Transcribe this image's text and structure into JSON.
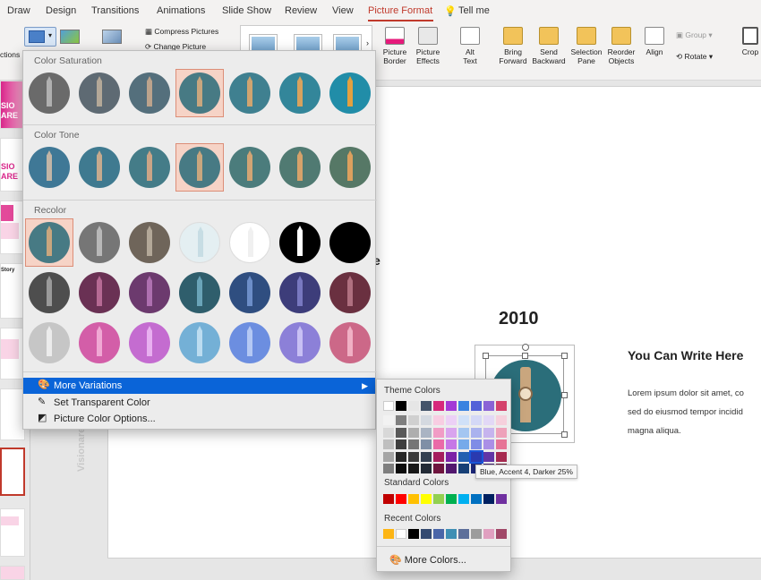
{
  "tabs": [
    {
      "label": "Draw",
      "active": false
    },
    {
      "label": "Design",
      "active": false
    },
    {
      "label": "Transitions",
      "active": false
    },
    {
      "label": "Animations",
      "active": false
    },
    {
      "label": "Slide Show",
      "active": false
    },
    {
      "label": "Review",
      "active": false
    },
    {
      "label": "View",
      "active": false
    },
    {
      "label": "Picture Format",
      "active": true
    },
    {
      "label": "Tell me",
      "active": false
    }
  ],
  "ribbon": {
    "partial_left_label": "ctions",
    "compress_label": "Compress Pictures",
    "change_label": "Change Picture",
    "picture_border": "Picture\nBorder",
    "picture_effects": "Picture\nEffects",
    "alt_text": "Alt\nText",
    "bring_forward": "Bring\nForward",
    "send_backward": "Send\nBackward",
    "selection_pane": "Selection\nPane",
    "reorder_objects": "Reorder\nObjects",
    "align": "Align",
    "group": "Group",
    "rotate": "Rotate",
    "crop": "Crop"
  },
  "slide": {
    "year": "2010",
    "heading": "You Can Write Here",
    "body": "Lorem ipsum dolor sit amet, co\nsed do eiusmod tempor incidid\nmagna aliqua.",
    "vertical_text": "Visionare - Presen",
    "partial_glyph": "e"
  },
  "thumbs": {
    "t1": "SIO\nARE",
    "t2": "SIO\nARE",
    "t3": "Story"
  },
  "dropdown": {
    "color_saturation": "Color Saturation",
    "color_tone": "Color Tone",
    "recolor": "Recolor",
    "more_variations": "More Variations",
    "set_transparent": "Set Transparent Color",
    "picture_color_options": "Picture Color Options...",
    "saturation_cells": [
      {
        "bg": "#6a6a6a",
        "tw": "#b0b0b0"
      },
      {
        "bg": "#5e6a73",
        "tw": "#b4a898"
      },
      {
        "bg": "#546f7c",
        "tw": "#bca38c"
      },
      {
        "bg": "#477a84",
        "tw": "#c9a67e"
      },
      {
        "bg": "#3f8090",
        "tw": "#d0a470"
      },
      {
        "bg": "#33869a",
        "tw": "#d8a25e"
      },
      {
        "bg": "#218da8",
        "tw": "#e2a040"
      }
    ],
    "tone_cells": [
      {
        "bg": "#3f7896",
        "tw": "#c2b5a6"
      },
      {
        "bg": "#3f7a90",
        "tw": "#c6aa8e"
      },
      {
        "bg": "#447c88",
        "tw": "#cba486"
      },
      {
        "bg": "#477a84",
        "tw": "#c9a67e"
      },
      {
        "bg": "#4b7c7c",
        "tw": "#d2a474"
      },
      {
        "bg": "#507a72",
        "tw": "#d6a26a"
      },
      {
        "bg": "#567866",
        "tw": "#dca05e"
      }
    ],
    "recolor_rows": [
      [
        {
          "bg": "#477a84",
          "tw": "#c9a67e"
        },
        {
          "bg": "#767676",
          "tw": "#b8b8b8"
        },
        {
          "bg": "#6f655a",
          "tw": "#b3a898"
        },
        {
          "bg": "#e4eff2",
          "tw": "#c7dde4"
        },
        {
          "bg": "#ffffff",
          "tw": "#f0f0f0"
        },
        {
          "bg": "#000000",
          "tw": "#ffffff"
        },
        {
          "bg": "#000000",
          "tw": "#000000"
        }
      ],
      [
        {
          "bg": "#4e4e4e",
          "tw": "#9a9a9a"
        },
        {
          "bg": "#6a3154",
          "tw": "#b66a94"
        },
        {
          "bg": "#6c3a6e",
          "tw": "#ae70b0"
        },
        {
          "bg": "#2f5e6c",
          "tw": "#6aa4b8"
        },
        {
          "bg": "#2f4e80",
          "tw": "#6c8ec8"
        },
        {
          "bg": "#3d3d7a",
          "tw": "#7878c0"
        },
        {
          "bg": "#6a3040",
          "tw": "#b07080"
        }
      ],
      [
        {
          "bg": "#c6c6c6",
          "tw": "#ececec"
        },
        {
          "bg": "#d35ea8",
          "tw": "#f0a8d4"
        },
        {
          "bg": "#c46cd0",
          "tw": "#e8b0f0"
        },
        {
          "bg": "#74b0d6",
          "tw": "#bcdcf0"
        },
        {
          "bg": "#6c8ee0",
          "tw": "#b4c8f4"
        },
        {
          "bg": "#8c80d8",
          "tw": "#c8c0f4"
        },
        {
          "bg": "#cc6888",
          "tw": "#f0b0c4"
        }
      ]
    ]
  },
  "color_panel": {
    "theme_colors": "Theme Colors",
    "standard_colors": "Standard Colors",
    "recent_colors": "Recent Colors",
    "more_colors": "More Colors...",
    "tooltip": "Blue, Accent 4, Darker 25%",
    "theme_top": [
      "#ffffff",
      "#000000",
      "#e6e6e6",
      "#44546a",
      "#d6297c",
      "#a33ad6",
      "#3a83e0",
      "#5361d8",
      "#8a63d6",
      "#d4436c"
    ],
    "theme_shades": [
      [
        "#f2f2f2",
        "#7f7f7f",
        "#d0d0d0",
        "#d4d9e0",
        "#f8cde2",
        "#ecd0f6",
        "#d0e1f8",
        "#d4d8f6",
        "#e2d8f6",
        "#f6d0dc"
      ],
      [
        "#d8d8d8",
        "#595959",
        "#aeaeae",
        "#aab4c3",
        "#f19cc5",
        "#d9a4ee",
        "#a4c6f1",
        "#aab2ee",
        "#c6b4ee",
        "#eea2ba"
      ],
      [
        "#bfbfbf",
        "#3f3f3f",
        "#767676",
        "#7f8fa6",
        "#ea6aa8",
        "#c678e6",
        "#76aaea",
        "#7f8ce6",
        "#aa8fe6",
        "#e67496"
      ],
      [
        "#a5a5a5",
        "#262626",
        "#3a3a3a",
        "#333f50",
        "#a51e5e",
        "#7c23a6",
        "#2260b0",
        "#2a3ab0",
        "#6236a6",
        "#a62a50"
      ],
      [
        "#7f7f7f",
        "#0c0c0c",
        "#171717",
        "#222a35",
        "#6e143e",
        "#52176e",
        "#174076",
        "#1c2676",
        "#41246e",
        "#6e1c36"
      ]
    ],
    "standard": [
      "#c00000",
      "#ff0000",
      "#ffc000",
      "#ffff00",
      "#92d050",
      "#00b050",
      "#00b0f0",
      "#0070c0",
      "#002060",
      "#7030a0"
    ],
    "recent": [
      "#fdb515",
      "#ffffff",
      "#000000",
      "#344a70",
      "#4a66a8",
      "#3f8fb4",
      "#5d6f9a",
      "#9c9c9c",
      "#e0a0c0",
      "#a04868"
    ],
    "selected_cell": "3-7"
  },
  "colors": {
    "accent_red": "#c0392b",
    "highlight_blue": "#0a64d8",
    "selected_cell_bg": "#f6d3c6",
    "big_ben_circle": "#2b6e7a"
  }
}
